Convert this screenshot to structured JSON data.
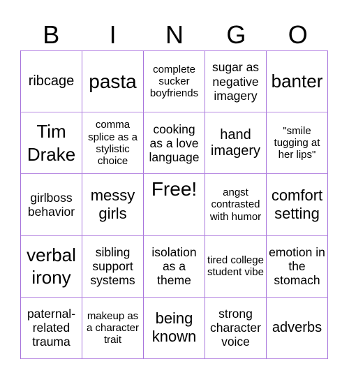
{
  "header": {
    "letters": [
      "B",
      "I",
      "N",
      "G",
      "O"
    ]
  },
  "colors": {
    "grid_line": "#a876dc",
    "text": "#000000",
    "background": "#ffffff"
  },
  "board": [
    [
      "ribcage",
      "pasta",
      "complete sucker boyfriends",
      "sugar as negative imagery",
      "banter"
    ],
    [
      "Tim Drake",
      "comma splice as a stylistic choice",
      "cooking as a love language",
      "hand imagery",
      "\"smile tugging at her lips\""
    ],
    [
      "girlboss behavior",
      "messy girls",
      "Free!",
      "angst contrasted with humor",
      "comfort setting"
    ],
    [
      "verbal irony",
      "sibling support systems",
      "isolation as a theme",
      "tired college student vibe",
      "emotion in the stomach"
    ],
    [
      "paternal-related trauma",
      "makeup as a character trait",
      "being known",
      "strong character voice",
      "adverbs"
    ]
  ]
}
